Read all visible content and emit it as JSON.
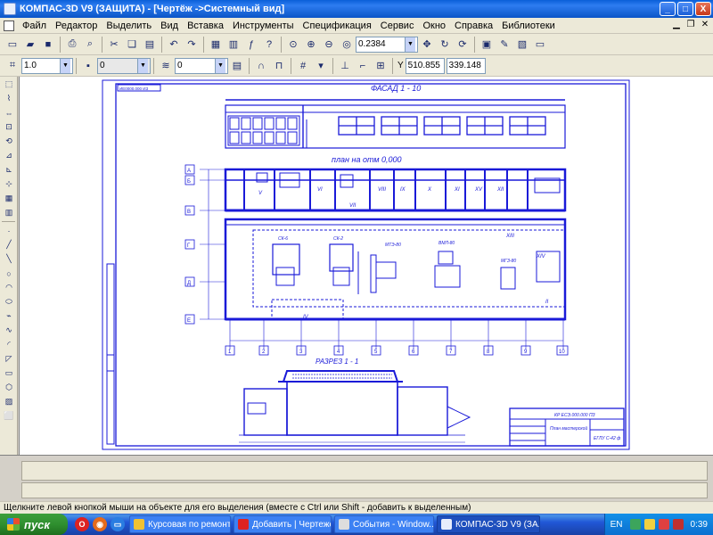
{
  "window": {
    "title": "КОМПАС-3D V9 (ЗАЩИТА) - [Чертёж ->Системный вид]",
    "min": "_",
    "max": "□",
    "close": "X"
  },
  "menu": [
    "Файл",
    "Редактор",
    "Выделить",
    "Вид",
    "Вставка",
    "Инструменты",
    "Спецификация",
    "Сервис",
    "Окно",
    "Справка",
    "Библиотеки"
  ],
  "toolbar1": {
    "zoom_value": "0.2384"
  },
  "toolbar2": {
    "line_scale": "1.0",
    "layer_placeholder": "0",
    "state_value": "0",
    "coord_label": "Y",
    "coord_x": "510.855",
    "coord_y": "339.148"
  },
  "drawing": {
    "facade_title": "ФАСАД 1 - 10",
    "plan_title": "план на отм 0,000",
    "section_title": "РАЗРЕЗ 1 - 1",
    "stamp_text": "ИЕ0000.000 ИЗ",
    "axes_cols": [
      "1",
      "2",
      "3",
      "4",
      "5",
      "6",
      "7",
      "8",
      "9",
      "10"
    ],
    "axes_rows": [
      "А",
      "Б",
      "В",
      "Г",
      "Д",
      "Е"
    ],
    "room_numerals": [
      "V",
      "VI",
      "VII",
      "VIII",
      "IX",
      "X",
      "XI",
      "XV",
      "XII",
      "XIII",
      "XIV",
      "IV",
      "II"
    ],
    "equipment_labels": [
      "СК-6",
      "СК-2",
      "МТЭ-80",
      "ВМЛ-80",
      "МГЗ-80"
    ],
    "title_block": {
      "code": "КР ЕСЭ.000.000 ПЗ",
      "name": "План мастерской",
      "sheet": "ЕГЛУ С-42 ф"
    }
  },
  "status": {
    "hint": "Щелкните левой кнопкой мыши на объекте для его выделения (вместе с Ctrl или Shift - добавить к выделенным)"
  },
  "taskbar": {
    "start": "пуск",
    "tasks": [
      "Курсовая по ремонту",
      "Добавить | Чертеже...",
      "События - Window...",
      "КОМПАС-3D V9 (ЗА..."
    ],
    "lang": "EN",
    "clock": "0:39"
  },
  "colors": {
    "drawing": "#1a1ad8",
    "title_bar": "#0a5fd8",
    "taskbar": "#2157d7"
  }
}
